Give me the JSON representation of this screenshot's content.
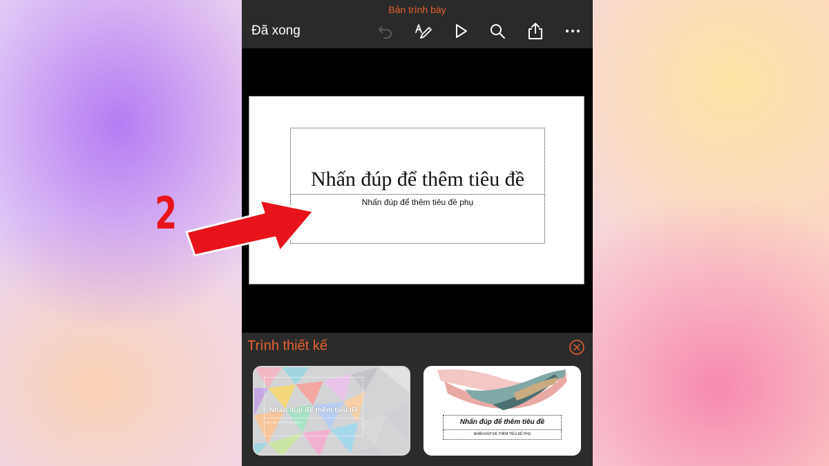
{
  "app": {
    "title": "Bản trình bày",
    "done_label": "Đã xong"
  },
  "toolbar": {
    "icons": [
      "undo-icon",
      "pen-icon",
      "play-icon",
      "search-icon",
      "share-icon",
      "more-icon"
    ]
  },
  "slide": {
    "title_placeholder": "Nhấn đúp để thêm tiêu đề",
    "subtitle_placeholder": "Nhấn đúp để thêm tiêu đề phụ"
  },
  "designer": {
    "title": "Trình thiết kế",
    "close_icon": "close-circle-icon",
    "cards": [
      {
        "title": "Nhấn đúp để thêm tiêu đề",
        "subtitle": "Nhấn đúp để thêm tiêu đề phụ"
      },
      {
        "title": "Nhấn đúp để thêm tiêu đề",
        "subtitle": "NHẤN ĐÚP ĐỂ THÊM TIÊU ĐỀ PHỤ"
      }
    ]
  },
  "annotation": {
    "number": "2"
  },
  "colors": {
    "accent": "#e8622c",
    "toolbar_bg": "#2a2a2a",
    "annotation_red": "#e8141b"
  }
}
